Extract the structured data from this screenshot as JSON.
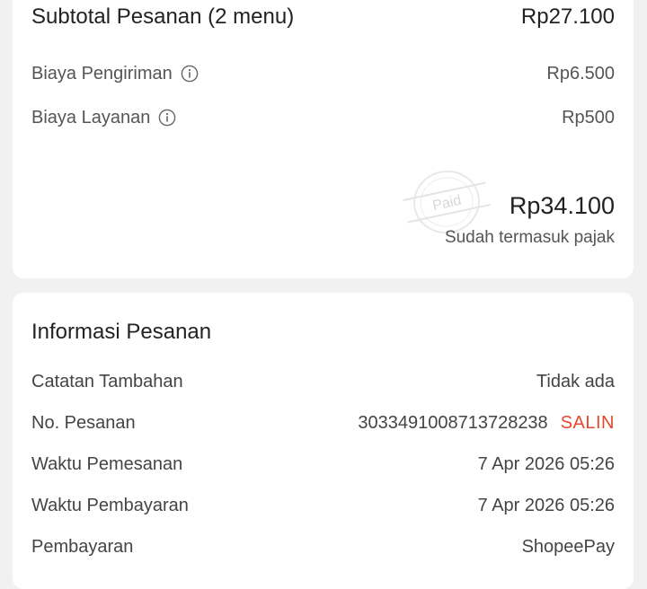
{
  "summary": {
    "subtotal_label": "Subtotal Pesanan (2 menu)",
    "subtotal_value": "Rp27.100",
    "shipping_label": "Biaya Pengiriman",
    "shipping_value": "Rp6.500",
    "service_label": "Biaya Layanan",
    "service_value": "Rp500",
    "total_value": "Rp34.100",
    "tax_note": "Sudah termasuk pajak",
    "stamp_text": "Paid"
  },
  "order_info": {
    "title": "Informasi Pesanan",
    "rows": [
      {
        "label": "Catatan Tambahan",
        "value": "Tidak ada"
      },
      {
        "label": "No. Pesanan",
        "value": "3033491008713728238",
        "action": "SALIN"
      },
      {
        "label": "Waktu Pemesanan",
        "value": "7 Apr 2026 05:26"
      },
      {
        "label": "Waktu Pembayaran",
        "value": "7 Apr 2026 05:26"
      },
      {
        "label": "Pembayaran",
        "value": "ShopeePay"
      }
    ]
  },
  "colors": {
    "accent": "#e8472b",
    "background": "#f1f1f1",
    "card": "#ffffff"
  },
  "icons": {
    "info": "info-circle-icon",
    "stamp": "paid-stamp"
  }
}
